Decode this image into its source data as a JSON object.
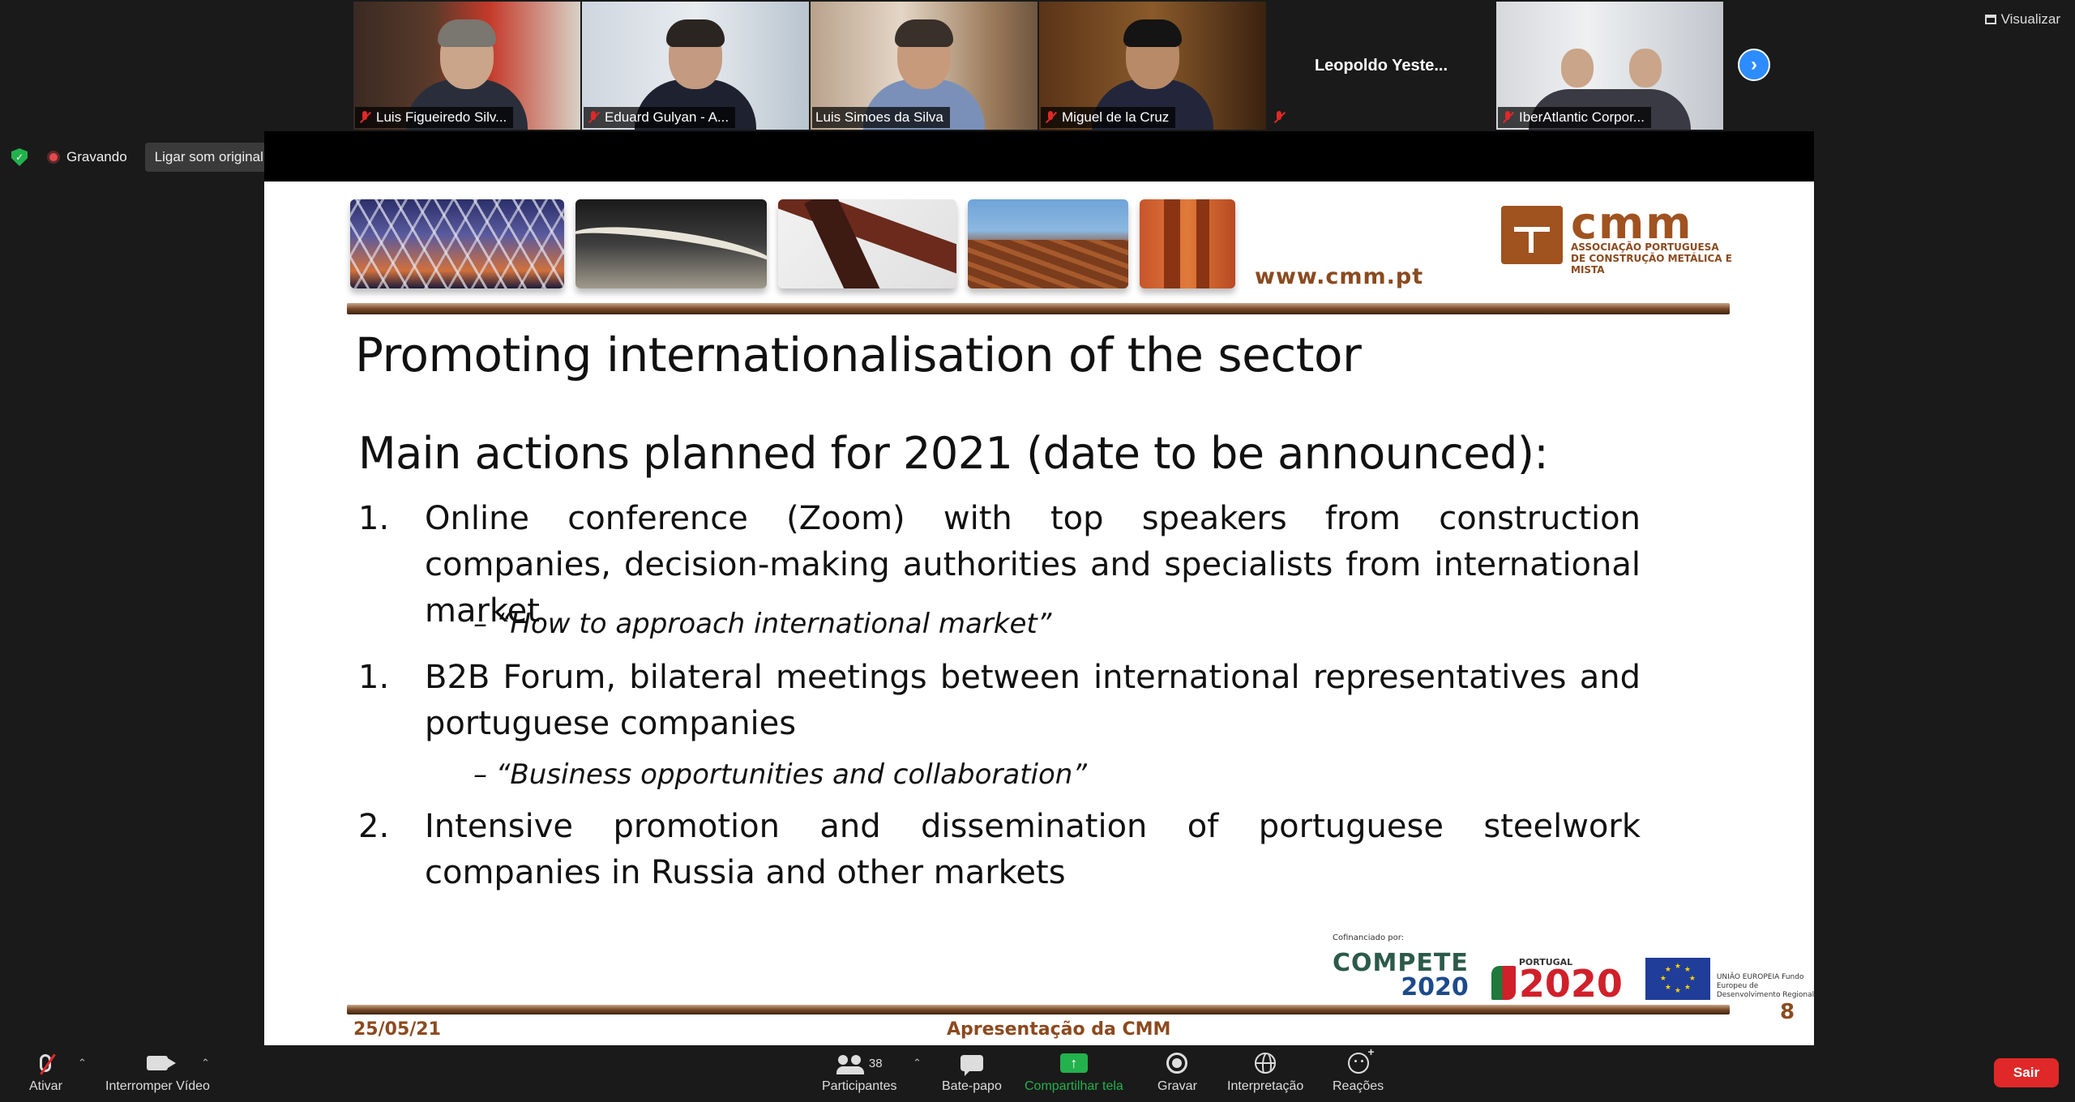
{
  "meeting": {
    "participants": [
      {
        "name": "Luis Figueiredo Silv...",
        "muted": true
      },
      {
        "name": "Eduard Gulyan - A...",
        "muted": true
      },
      {
        "name": "Luis Simoes da Silva",
        "muted": false,
        "active": true
      },
      {
        "name": "Miguel de la Cruz",
        "muted": true
      },
      {
        "name": "Leopoldo Yeste...",
        "muted": true,
        "video": false
      },
      {
        "name": "IberAtlantic Corpor...",
        "muted": true
      }
    ],
    "view_label": "Visualizar",
    "recording_label": "Gravando",
    "original_sound_label": "Ligar som original"
  },
  "slide": {
    "website": "www.cmm.pt",
    "logo_name": "cmm",
    "logo_tagline": "ASSOCIAÇÃO PORTUGUESA DE CONSTRUÇÃO METÁLICA E MISTA",
    "title": "Promoting internationalisation of the sector",
    "subtitle": "Main actions planned for 2021 (date to be announced):",
    "items": [
      {
        "num": "1.",
        "text": "Online conference (Zoom) with top speakers from construction companies, decision-making authorities and specialists from international market",
        "sub": "– “How to approach international market”"
      },
      {
        "num": "1.",
        "text": "B2B Forum, bilateral meetings between international representatives and portuguese companies",
        "sub": "– “Business opportunities and collaboration”"
      },
      {
        "num": "2.",
        "text": "Intensive promotion and dissemination of portuguese steelwork companies in Russia and other markets",
        "sub": ""
      }
    ],
    "cofinanced_label": "Cofinanciado por:",
    "compete_word": "COMPETE",
    "compete_year": "2020",
    "portugal_label": "PORTUGAL",
    "portugal_year": "2020",
    "eu_text": "UNIÃO EUROPEIA Fundo Europeu de Desenvolvimento Regional",
    "footer_date": "25/05/21",
    "footer_center": "Apresentação da CMM",
    "page_number": "8"
  },
  "toolbar": {
    "mute_label": "Ativar",
    "video_label": "Interromper Vídeo",
    "participants_label": "Participantes",
    "participants_count": "38",
    "chat_label": "Bate-papo",
    "share_label": "Compartilhar tela",
    "record_label": "Gravar",
    "interpret_label": "Interpretação",
    "reactions_label": "Reações",
    "leave_label": "Sair"
  },
  "colors": {
    "accent_brown": "#8b4a1f",
    "share_green": "#23b14d",
    "leave_red": "#e02828",
    "active_border": "#7bc043",
    "next_blue": "#2d8cff"
  }
}
